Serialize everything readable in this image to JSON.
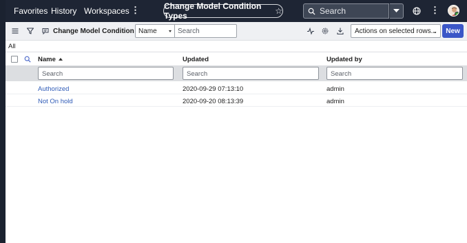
{
  "header": {
    "nav": [
      "Favorites",
      "History",
      "Workspaces"
    ],
    "more_glyph": "⋮",
    "page_title": "Change Model Condition Types",
    "search_placeholder": "Search",
    "caret_glyph": "▾"
  },
  "toolbar": {
    "list_title": "Change Model Condition Types",
    "field_select_value": "Name",
    "search_placeholder": "Search",
    "actions_label": "Actions on selected rows...",
    "new_label": "New"
  },
  "breadcrumb": "All",
  "table": {
    "columns": [
      "Name",
      "Updated",
      "Updated by"
    ],
    "search_placeholder": "Search",
    "rows": [
      {
        "name": "Authorized",
        "updated": "2020-09-29 07:13:10",
        "updated_by": "admin"
      },
      {
        "name": "Not On hold",
        "updated": "2020-09-20 08:13:39",
        "updated_by": "admin"
      }
    ]
  },
  "colors": {
    "header_bg": "#1e2534",
    "toolbar_bg": "#eff0f3",
    "primary_button": "#3b56c7",
    "link": "#2f5bb7"
  }
}
